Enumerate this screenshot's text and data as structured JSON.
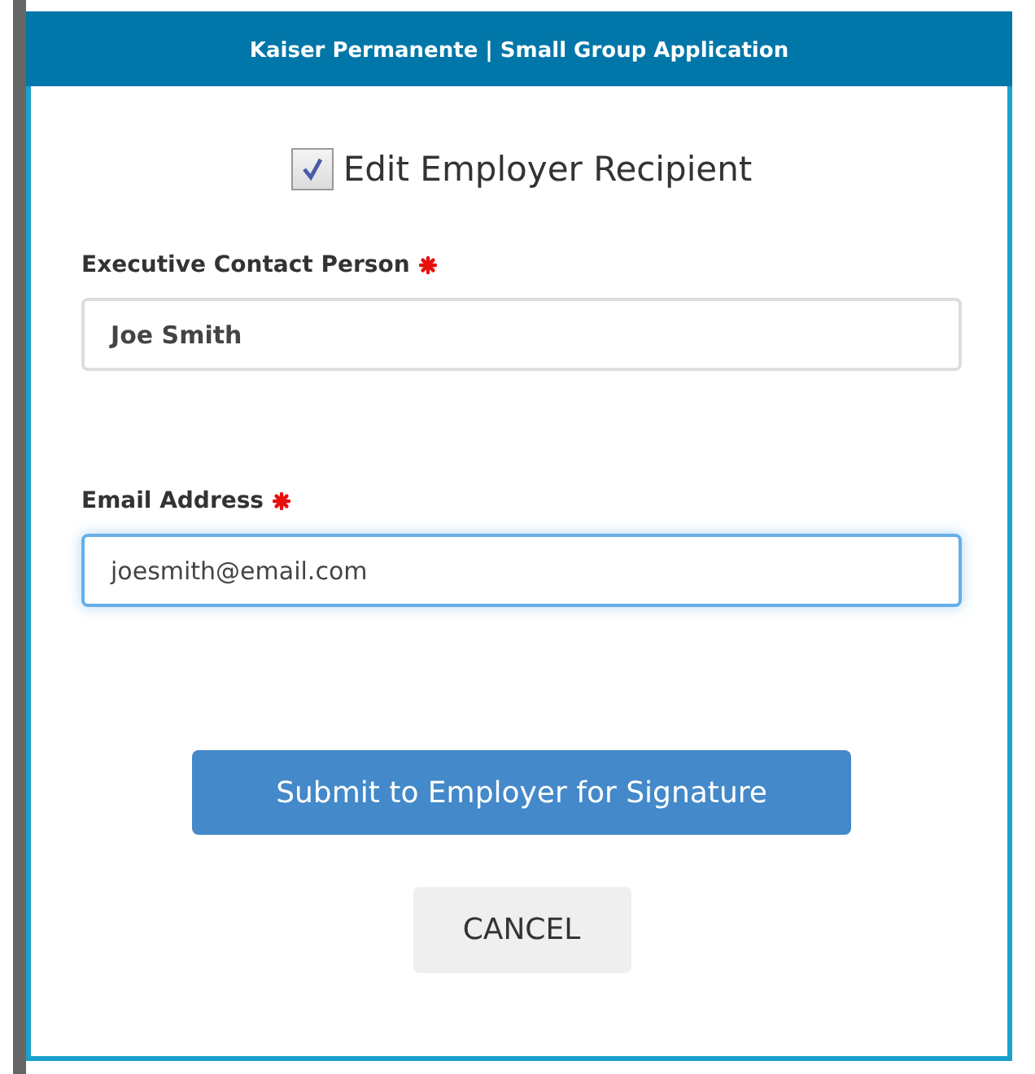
{
  "dialog": {
    "title": "Kaiser Permanente | Small Group Application"
  },
  "checkbox": {
    "label": "Edit Employer Recipient",
    "checked": true
  },
  "fields": [
    {
      "label": "Executive Contact Person",
      "required": true,
      "value": "Joe Smith",
      "focused": false
    },
    {
      "label": "Email Address",
      "required": true,
      "value": "joesmith@email.com",
      "focused": true
    }
  ],
  "buttons": [
    {
      "label": "Submit to Employer for Signature",
      "kind": "primary"
    },
    {
      "label": "CANCEL",
      "kind": "secondary"
    }
  ]
}
